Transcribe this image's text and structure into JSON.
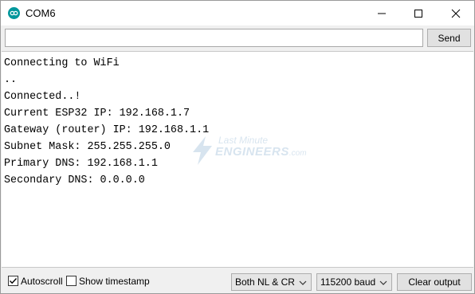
{
  "window": {
    "title": "COM6",
    "icon": "arduino-icon",
    "controls": [
      "minimize-icon",
      "maximize-icon",
      "close-icon"
    ]
  },
  "send_row": {
    "input_value": "",
    "send_label": "Send"
  },
  "output": {
    "lines": [
      "Connecting to WiFi",
      "..",
      "Connected..!",
      "Current ESP32 IP: 192.168.1.7",
      "Gateway (router) IP: 192.168.1.1",
      "Subnet Mask: 255.255.255.0",
      "Primary DNS: 192.168.1.1",
      "Secondary DNS: 0.0.0.0"
    ],
    "watermark": {
      "line1": "Last Minute",
      "line2": "ENGINEERS",
      "suffix": ".com"
    }
  },
  "bottom_bar": {
    "autoscroll": {
      "label": "Autoscroll",
      "checked": true
    },
    "show_timestamp": {
      "label": "Show timestamp",
      "checked": false
    },
    "line_ending": {
      "selected": "Both NL & CR"
    },
    "baud_rate": {
      "selected": "115200 baud"
    },
    "clear_label": "Clear output"
  },
  "colors": {
    "icon_teal": "#00979c",
    "watermark_blue": "#2a6ea8",
    "chrome": "#f0f0f0"
  }
}
